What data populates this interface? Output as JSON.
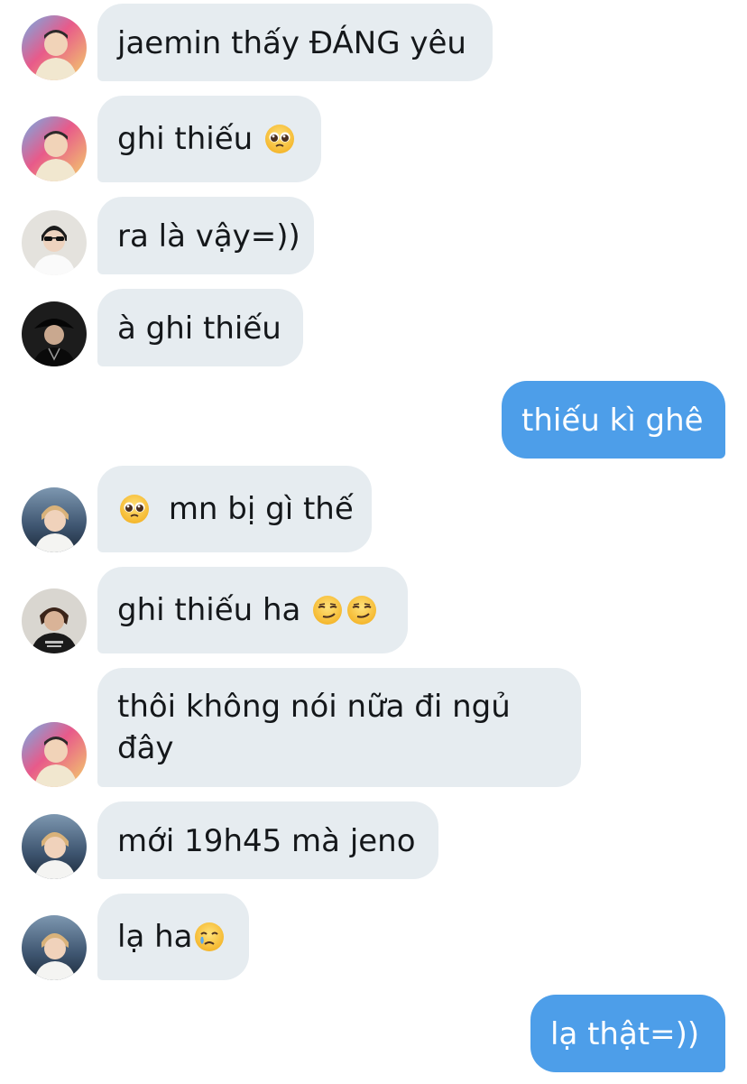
{
  "messages": [
    {
      "text": "jaemin thấy ĐÁNG yêu",
      "sender": "jaemin"
    },
    {
      "text": "ghi thiếu ",
      "sender": "jaemin",
      "emoji": "pleading-face"
    },
    {
      "text": "ra là vậy=))",
      "sender": "user-white-shirt"
    },
    {
      "text": "à ghi thiếu",
      "sender": "user-black-hat"
    },
    {
      "text": "thiếu kì ghê",
      "sender": "me"
    },
    {
      "text": "mn bị gì thế",
      "sender": "jeno",
      "emoji_before": "pleading-face"
    },
    {
      "text": "ghi thiếu ha ",
      "sender": "user-dark-hoodie",
      "emoji": "smirking-face-x2"
    },
    {
      "text": "thôi không nói nữa đi ngủ đây",
      "sender": "jaemin"
    },
    {
      "text": "mới 19h45 mà jeno",
      "sender": "jeno"
    },
    {
      "text": "lạ ha",
      "sender": "jeno",
      "emoji": "face-holding-back-tears"
    },
    {
      "text": "lạ thật=))",
      "sender": "me"
    }
  ],
  "colors": {
    "incoming_bubble": "#e6ecf0",
    "outgoing_bubble": "#4d9ee9",
    "text_dark": "#14171a",
    "text_light": "#ffffff"
  }
}
